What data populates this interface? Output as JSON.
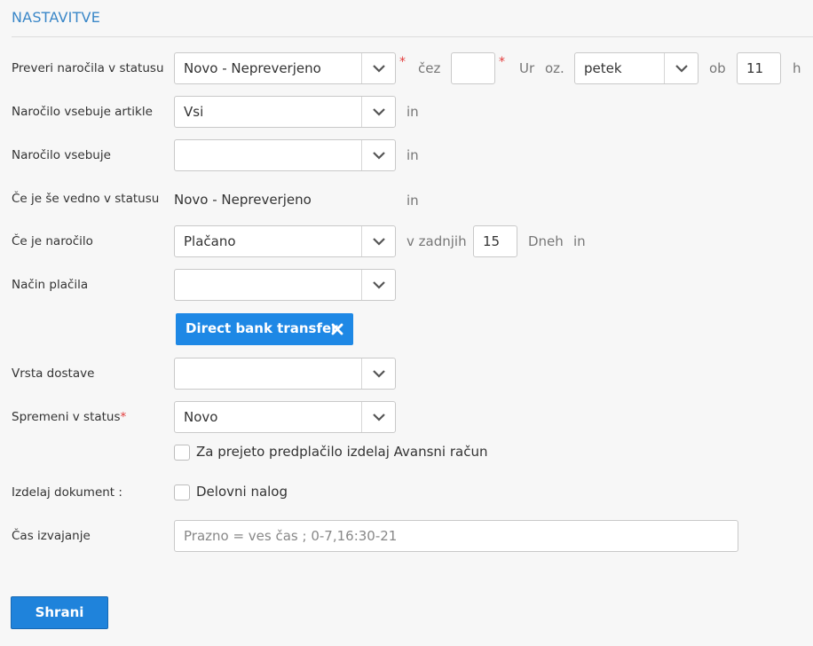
{
  "section": {
    "title": "NASTAVITVE"
  },
  "row1": {
    "label": "Preveri naročila v statusu",
    "status_value": "Novo - Nepreverjeno",
    "cez": "čez",
    "hours_value": "",
    "ur": "Ur",
    "oz": "oz.",
    "day_value": "petek",
    "ob": "ob",
    "time_value": "11",
    "h": "h",
    "required_mark": "*"
  },
  "row2": {
    "label": "Naročilo vsebuje artikle",
    "value": "Vsi",
    "suffix": "in"
  },
  "row3": {
    "label": "Naročilo vsebuje",
    "value": "",
    "suffix": "in"
  },
  "row4": {
    "label": "Če je še vedno v statusu",
    "value": "Novo - Nepreverjeno",
    "suffix": "in"
  },
  "row5": {
    "label": "Če je naročilo",
    "value": "Plačano",
    "v_zadnjih": "v zadnjih",
    "days_value": "15",
    "dneh": "Dneh",
    "suffix": "in"
  },
  "row6": {
    "label": "Način plačila",
    "value": "",
    "tag": "Direct bank transfer"
  },
  "row7": {
    "label": "Vrsta dostave",
    "value": ""
  },
  "row8": {
    "label": "Spremeni v status",
    "required_mark": "*",
    "value": "Novo"
  },
  "checkbox_avans": {
    "label": "Za prejeto predplačilo izdelaj Avansni račun",
    "checked": false
  },
  "row9": {
    "label": "Izdelaj dokument :",
    "checkbox_label": "Delovni nalog",
    "checked": false
  },
  "row10": {
    "label": "Čas izvajanje",
    "placeholder": "Prazno = ves čas ; 0-7,16:30-21"
  },
  "actions": {
    "save_label": "Shrani"
  },
  "colors": {
    "accent": "#1e88e5",
    "title": "#3a87c8",
    "required": "#e23b3b"
  }
}
